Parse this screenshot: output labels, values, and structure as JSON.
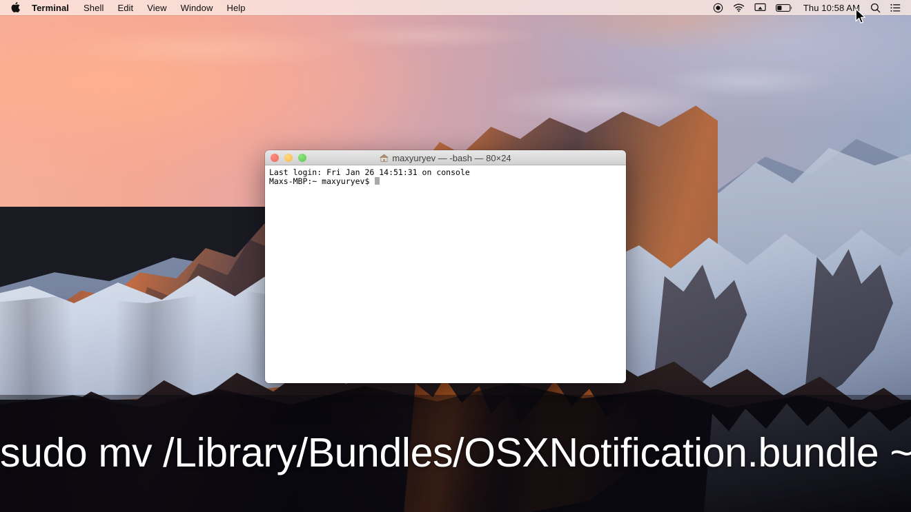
{
  "menubar": {
    "apple_icon": "apple-logo",
    "items": [
      {
        "label": "Terminal",
        "bold": true
      },
      {
        "label": "Shell",
        "bold": false
      },
      {
        "label": "Edit",
        "bold": false
      },
      {
        "label": "View",
        "bold": false
      },
      {
        "label": "Window",
        "bold": false
      },
      {
        "label": "Help",
        "bold": false
      }
    ],
    "status_icons": [
      "screen-recording-icon",
      "wifi-icon",
      "airplay-display-icon",
      "battery-icon"
    ],
    "clock": "Thu 10:58 AM",
    "spotlight_icon": "search-icon",
    "notification_center_icon": "notification-center-icon"
  },
  "terminal": {
    "title": "maxyuryev — -bash — 80×24",
    "title_icon": "home-folder-icon",
    "traffic_lights": [
      {
        "name": "close-button",
        "color": "#ec6a5e"
      },
      {
        "name": "minimize-button",
        "color": "#f4bd4f"
      },
      {
        "name": "zoom-button",
        "color": "#61c554"
      }
    ],
    "lines": [
      "Last login: Fri Jan 26 14:51:31 on console",
      "Maxs-MBP:~ maxyuryev$ "
    ],
    "cursor": "block-cursor"
  },
  "caption": {
    "text": "sudo mv /Library/Bundles/OSXNotification.bundle ~/Documents/"
  },
  "desktop": {
    "wallpaper": "macos-sierra-lone-pine-peak",
    "pointer": "arrow-cursor"
  },
  "colors": {
    "menubar_bg": "#fae8e4",
    "terminal_bg": "#ffffff",
    "terminal_text": "#000000",
    "caption_text": "#ffffff",
    "sky_left": "#f6b09a",
    "sky_right": "#9aa9c2"
  }
}
